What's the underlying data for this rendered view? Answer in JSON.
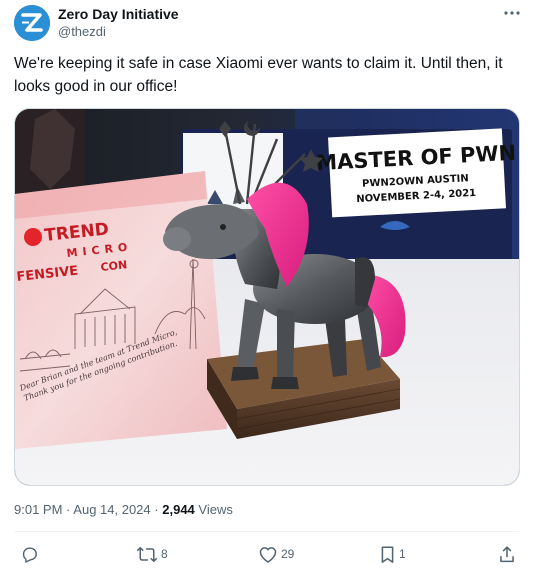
{
  "author": {
    "name": "Zero Day Initiative",
    "handle": "@thezdi",
    "avatar_icon": "zdi-logo-icon",
    "avatar_color": "#2b8fd6"
  },
  "tweet": {
    "text": "We're keeping it safe in case Xiaomi ever wants to claim it. Until then, it looks good in our office!"
  },
  "media": {
    "sign": {
      "line1": "MASTER OF PWN",
      "line2": "PWN2OWN AUSTIN",
      "line3": "NOVEMBER 2-4, 2021"
    },
    "bag": {
      "brand_line1": "TREND",
      "brand_line2": "MICRO",
      "brand_line3": "FENSIVE",
      "brand_line4": "CON",
      "note_line1": "Dear Brian and the team at Trend Micro,",
      "note_line2": "Thank you for the ongoing contribution."
    }
  },
  "meta": {
    "time": "9:01 PM",
    "separator": "·",
    "date": "Aug 14, 2024",
    "views_count": "2,944",
    "views_label": "Views"
  },
  "actions": {
    "reply_count": "",
    "retweet_count": "8",
    "like_count": "29",
    "bookmark_count": "1"
  },
  "colors": {
    "text_primary": "#0f1419",
    "text_secondary": "#536471",
    "divider": "#eff3f4",
    "accent": "#1d9bf0"
  }
}
